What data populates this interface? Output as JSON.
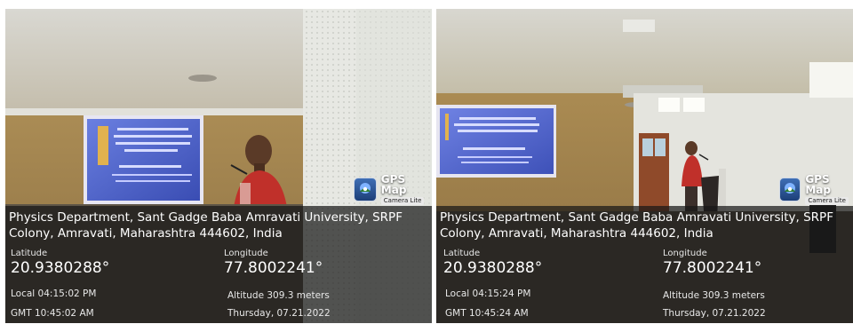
{
  "photos": [
    {
      "badge": {
        "title": "GPS Map",
        "subtitle": "Camera Lite"
      },
      "address": "Physics Department, Sant Gadge Baba Amravati University, SRPF Colony, Amravati, Maharashtra 444602, India",
      "latitude_label": "Latitude",
      "latitude": "20.9380288°",
      "longitude_label": "Longitude",
      "longitude": "77.8002241°",
      "local_time": "Local 04:15:02 PM",
      "gmt_time": "GMT 10:45:02 AM",
      "altitude": "Altitude 309.3 meters",
      "date": "Thursday, 07.21.2022"
    },
    {
      "badge": {
        "title": "GPS Map",
        "subtitle": "Camera Lite"
      },
      "address": "Physics Department, Sant Gadge Baba Amravati University, SRPF Colony, Amravati, Maharashtra 444602, India",
      "latitude_label": "Latitude",
      "latitude": "20.9380288°",
      "longitude_label": "Longitude",
      "longitude": "77.8002241°",
      "local_time": "Local 04:15:24 PM",
      "gmt_time": "GMT 10:45:24 AM",
      "altitude": "Altitude 309.3 meters",
      "date": "Thursday, 07.21.2022"
    }
  ],
  "colors": {
    "wall": "#a98a52",
    "panel_white": "#e9eae6",
    "projection": "#4b5fc4",
    "shirt": "#c0302a",
    "floor": "#5e5547"
  }
}
